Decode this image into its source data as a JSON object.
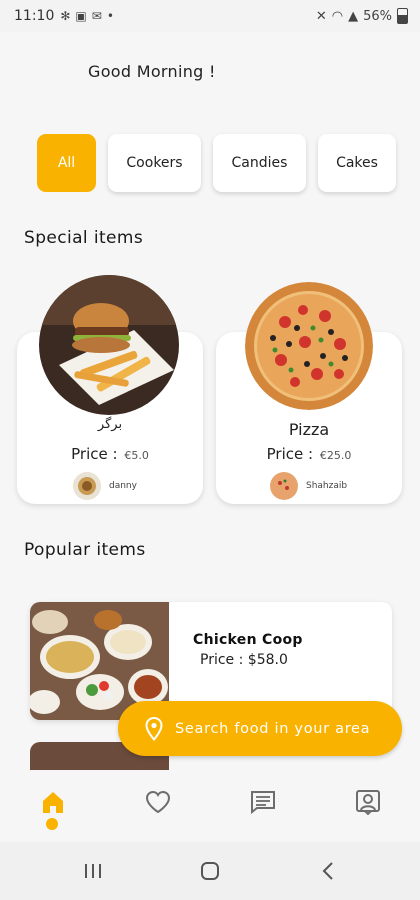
{
  "status_bar": {
    "time": "11:10",
    "battery": "56%"
  },
  "greeting": "Good Morning !",
  "categories": [
    {
      "label": "All",
      "active": true
    },
    {
      "label": "Cookers",
      "active": false
    },
    {
      "label": "Candies",
      "active": false
    },
    {
      "label": "Cakes",
      "active": false
    }
  ],
  "special": {
    "title": "Special items",
    "items": [
      {
        "name": "برگر",
        "price_label": "Price :",
        "price": "€5.0",
        "seller": "danny"
      },
      {
        "name": "Pizza",
        "price_label": "Price :",
        "price": "€25.0",
        "seller": "Shahzaib"
      }
    ]
  },
  "popular": {
    "title": "Popular items",
    "items": [
      {
        "name": "Chicken Coop",
        "price_label": "Price :",
        "price": "$58.0"
      }
    ]
  },
  "fab": {
    "label": "Search food in your area"
  },
  "nav": {
    "items": [
      "home-icon",
      "heart-icon",
      "chat-icon",
      "profile-icon"
    ],
    "active": "home-icon"
  },
  "colors": {
    "accent": "#f9b200",
    "background": "#f6f6f6"
  }
}
